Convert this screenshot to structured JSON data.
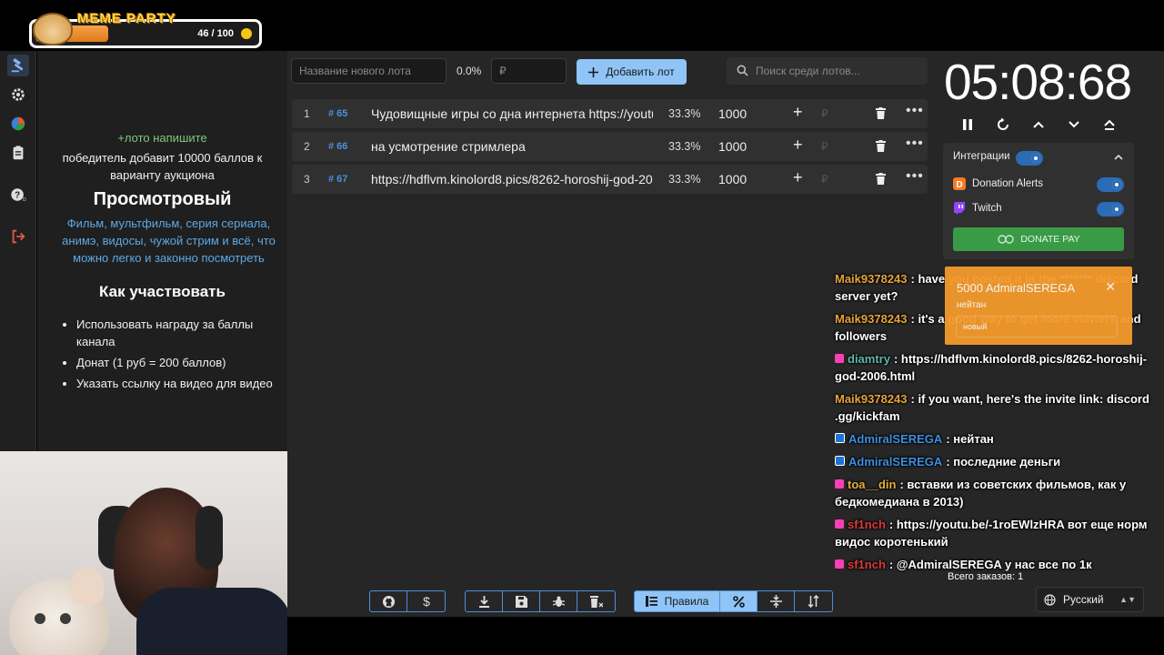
{
  "banner": {
    "title": "MEME PARTY",
    "progress_text": "46 / 100",
    "progress": 0.46
  },
  "rules": {
    "line1": "+лото напишите",
    "line2": "победитель добавит 10000 баллов к варианту аукциона",
    "heading": "Просмотровый",
    "description": "Фильм, мультфильм, серия сериала, анимэ, видосы, чужой стрим и всё, что можно легко и законно посмотреть",
    "how_heading": "Как участвовать",
    "items": [
      "Использовать награду за баллы канала",
      "Донат (1 руб = 200 баллов)",
      "Указать ссылку на видео для видео"
    ]
  },
  "toolbar_top": {
    "new_lot_placeholder": "Название нового лота",
    "percent": "0.0%",
    "amount_placeholder": "₽",
    "add_label": "Добавить лот",
    "search_placeholder": "Поиск среди лотов..."
  },
  "lots": [
    {
      "num": "1",
      "id": "# 65",
      "name": "Чудовищные игры со дна интернета https://youtu.be/",
      "pct": "33.3%",
      "amount": "1000"
    },
    {
      "num": "2",
      "id": "# 66",
      "name": " на усмотрение стримлера",
      "pct": "33.3%",
      "amount": "1000"
    },
    {
      "num": "3",
      "id": "# 67",
      "name": "https://hdflvm.kinolord8.pics/8262-horoshij-god-2006.html",
      "pct": "33.3%",
      "amount": "1000"
    }
  ],
  "timer": "05:08:68",
  "integrations": {
    "title": "Интеграции",
    "items": [
      {
        "label": "Donation Alerts"
      },
      {
        "label": "Twitch"
      }
    ],
    "donatepay": "DONATE PAY"
  },
  "alert": {
    "line1": "5000 AdmiralSEREGA",
    "line2": "нейтан",
    "line3": "новый"
  },
  "chat": [
    {
      "user": "Maik9378243",
      "color": "#e8a33c",
      "badge": "",
      "text": ": have you posted it in the ******* discord server yet?"
    },
    {
      "user": "Maik9378243",
      "color": "#e8a33c",
      "badge": "",
      "text": ": it's a good way to get more viewers and followers"
    },
    {
      "user": "diamtry",
      "color": "#5fb8a8",
      "badge": "pink",
      "text": ": https://hdflvm.kinolord8.pics/8262-horoshij-god-2006.html"
    },
    {
      "user": "Maik9378243",
      "color": "#e8a33c",
      "badge": "",
      "text": ": if you want, here's the invite link: discord .gg/kickfam"
    },
    {
      "user": "AdmiralSEREGA",
      "color": "#3f8fe0",
      "badge": "blue",
      "text": ": нейтан"
    },
    {
      "user": "AdmiralSEREGA",
      "color": "#3f8fe0",
      "badge": "blue",
      "text": ": последние деньги"
    },
    {
      "user": "toa__din",
      "color": "#e8b03c",
      "badge": "pink",
      "text": ": вставки из советских фильмов, как у бедкомедиана в 2013)"
    },
    {
      "user": "sf1nch",
      "color": "#e03a3a",
      "badge": "pink",
      "text": ": https://youtu.be/-1roEWlzHRA вот еще норм видос коротенький"
    },
    {
      "user": "sf1nch",
      "color": "#e03a3a",
      "badge": "pink",
      "text": ": @AdmiralSEREGA у нас все по 1к"
    }
  ],
  "orders": "Всего заказов: 1",
  "language": "Русский",
  "bottom_toolbar": {
    "rules_label": "Правила"
  },
  "colors": {
    "accent": "#90c4f7",
    "id_blue": "#4a90d9",
    "donatepay_green": "#3a9b47",
    "alert_orange": "#f49a2b"
  }
}
